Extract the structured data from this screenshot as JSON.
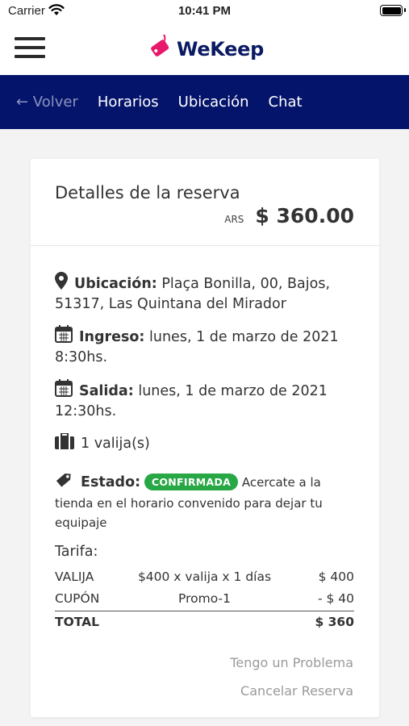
{
  "status_bar": {
    "carrier": "Carrier",
    "time": "10:41 PM"
  },
  "header": {
    "logo_text": "WeKeep",
    "brand_color": "#0b1a63",
    "logo_accent": "#e8196c"
  },
  "nav": {
    "back_label": "← Volver",
    "items": [
      {
        "label": "Horarios"
      },
      {
        "label": "Ubicación"
      },
      {
        "label": "Chat"
      }
    ],
    "background": "#05146b"
  },
  "reservation": {
    "title": "Detalles de la reserva",
    "currency": "ARS",
    "price": "$ 360.00",
    "location_label": "Ubicación:",
    "location_value": "Plaça Bonilla, 00, Bajos, 51317, Las Quintana del Mirador",
    "checkin_label": "Ingreso:",
    "checkin_value": "lunes, 1 de marzo de 2021 8:30hs.",
    "checkout_label": "Salida:",
    "checkout_value": "lunes, 1 de marzo de 2021 12:30hs.",
    "luggage": "1 valija(s)",
    "status_label": "Estado:",
    "status_badge": "CONFIRMADA",
    "status_color": "#28a745",
    "status_message": "Acercate a la tienda en el horario convenido para dejar tu equipaje"
  },
  "tarifa": {
    "label": "Tarifa:",
    "rows": [
      {
        "name": "VALIJA",
        "detail": "$400 x valija x 1 días",
        "amount": "$ 400"
      },
      {
        "name": "CUPÓN",
        "detail": "Promo-1",
        "amount": "- $ 40"
      }
    ],
    "total_label": "TOTAL",
    "total_amount": "$ 360"
  },
  "actions": {
    "problem": "Tengo un Problema",
    "cancel": "Cancelar Reserva"
  }
}
